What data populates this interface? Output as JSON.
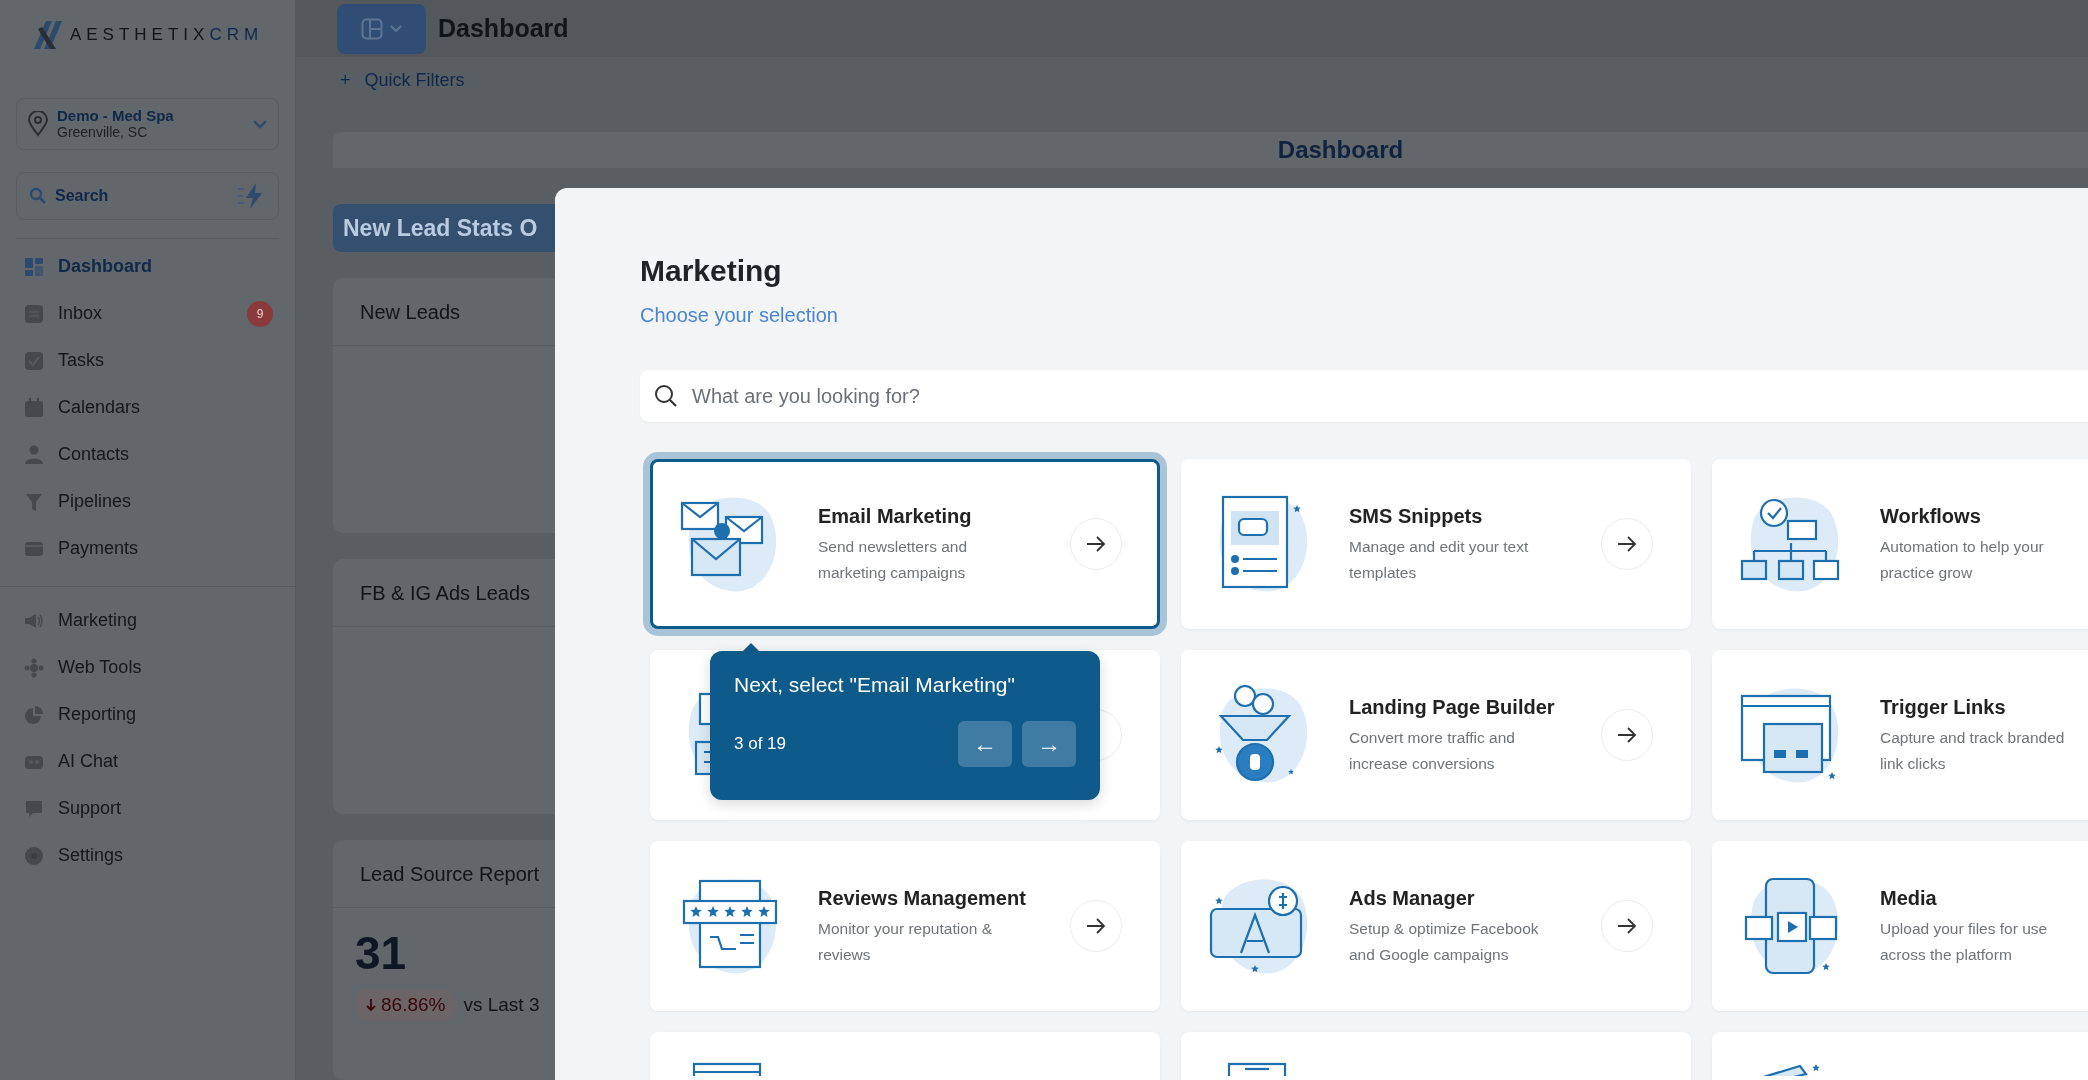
{
  "sidebar": {
    "logo": {
      "text": "AESTHETIX",
      "accent": "CRM"
    },
    "location": {
      "name": "Demo - Med Spa",
      "city": "Greenville, SC"
    },
    "search": {
      "label": "Search"
    },
    "nav_groups": [
      [
        {
          "label": "Dashboard",
          "selected": true
        },
        {
          "label": "Inbox",
          "selected": false,
          "badge": "9"
        },
        {
          "label": "Tasks",
          "selected": false
        },
        {
          "label": "Calendars",
          "selected": false
        },
        {
          "label": "Contacts",
          "selected": false
        },
        {
          "label": "Pipelines",
          "selected": false
        },
        {
          "label": "Payments",
          "selected": false
        }
      ],
      [
        {
          "label": "Marketing",
          "selected": false
        },
        {
          "label": "Web Tools",
          "selected": false
        },
        {
          "label": "Reporting",
          "selected": false
        },
        {
          "label": "AI Chat",
          "selected": false
        },
        {
          "label": "Support",
          "selected": false
        },
        {
          "label": "Settings",
          "selected": false
        }
      ]
    ]
  },
  "header": {
    "title": "Dashboard",
    "quick_filters": {
      "icon": "+",
      "label": "Quick Filters"
    }
  },
  "dashboard": {
    "banner": "Dashboard",
    "section_tab": "New Lead Stats O",
    "panels": [
      {
        "title": "New Leads"
      },
      {
        "title": "FB & IG Ads Leads"
      },
      {
        "title": "Lead Source Report",
        "value": "31",
        "change": "86.86%",
        "falling": true,
        "comparison": "vs Last 3"
      }
    ]
  },
  "modal": {
    "title": "Marketing",
    "subtitle": "Choose your selection",
    "search": {
      "placeholder": "What are you looking for?"
    },
    "cards": [
      {
        "kind": "full",
        "title": "Email Marketing",
        "description": "Send newsletters and marketing campaigns",
        "selected": true,
        "arrow": true
      },
      {
        "kind": "full",
        "title": "SMS Snippets",
        "description": "Manage and edit your text templates",
        "selected": false,
        "arrow": true
      },
      {
        "kind": "full",
        "title": "Workflows",
        "description": "Automation to help your practice grow",
        "selected": false,
        "arrow": false
      },
      {
        "kind": "covered",
        "selected": false,
        "arrow": true
      },
      {
        "kind": "full",
        "title": "Landing Page Builder",
        "description": "Convert more traffic and increase conversions",
        "selected": false,
        "arrow": true
      },
      {
        "kind": "full",
        "title": "Trigger Links",
        "description": "Capture and track branded link clicks",
        "selected": false,
        "arrow": false
      },
      {
        "kind": "full",
        "title": "Reviews Management",
        "description": "Monitor your reputation & reviews",
        "selected": false,
        "arrow": true
      },
      {
        "kind": "full",
        "title": "Ads Manager",
        "description": "Setup & optimize Facebook and Google campaigns",
        "selected": false,
        "arrow": true
      },
      {
        "kind": "full",
        "title": "Media",
        "description": "Upload your files for use across the platform",
        "selected": false,
        "arrow": false
      },
      {
        "kind": "partial",
        "selected": false,
        "arrow": false
      },
      {
        "kind": "partial",
        "selected": false,
        "arrow": false
      },
      {
        "kind": "partial",
        "selected": false,
        "arrow": false
      }
    ]
  },
  "tour": {
    "text": "Next, select \"Email Marketing\"",
    "step": "3 of 19",
    "buttons": [
      "←",
      "→"
    ]
  }
}
